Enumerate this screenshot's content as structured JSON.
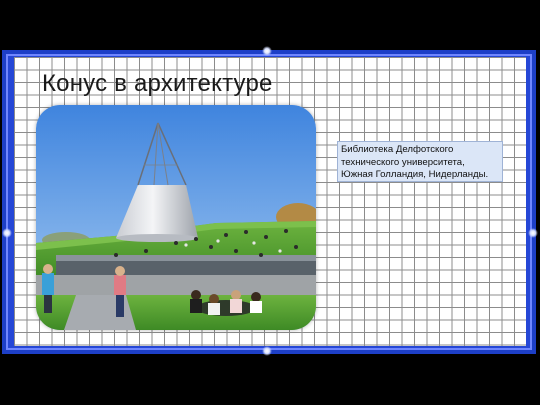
{
  "slide": {
    "title": "Конус в архитектуре",
    "caption": "Библиотека Делфотского технического университета, Южная Голландия, Нидерланды."
  },
  "photo": {
    "subject": "library-cone-photo"
  },
  "colors": {
    "frame": "#1d3fc7",
    "grid_line": "#8c8c8c",
    "caption_bg": "#dbe6f7",
    "sky": "#4a8de0",
    "grass": "#5fa836"
  }
}
